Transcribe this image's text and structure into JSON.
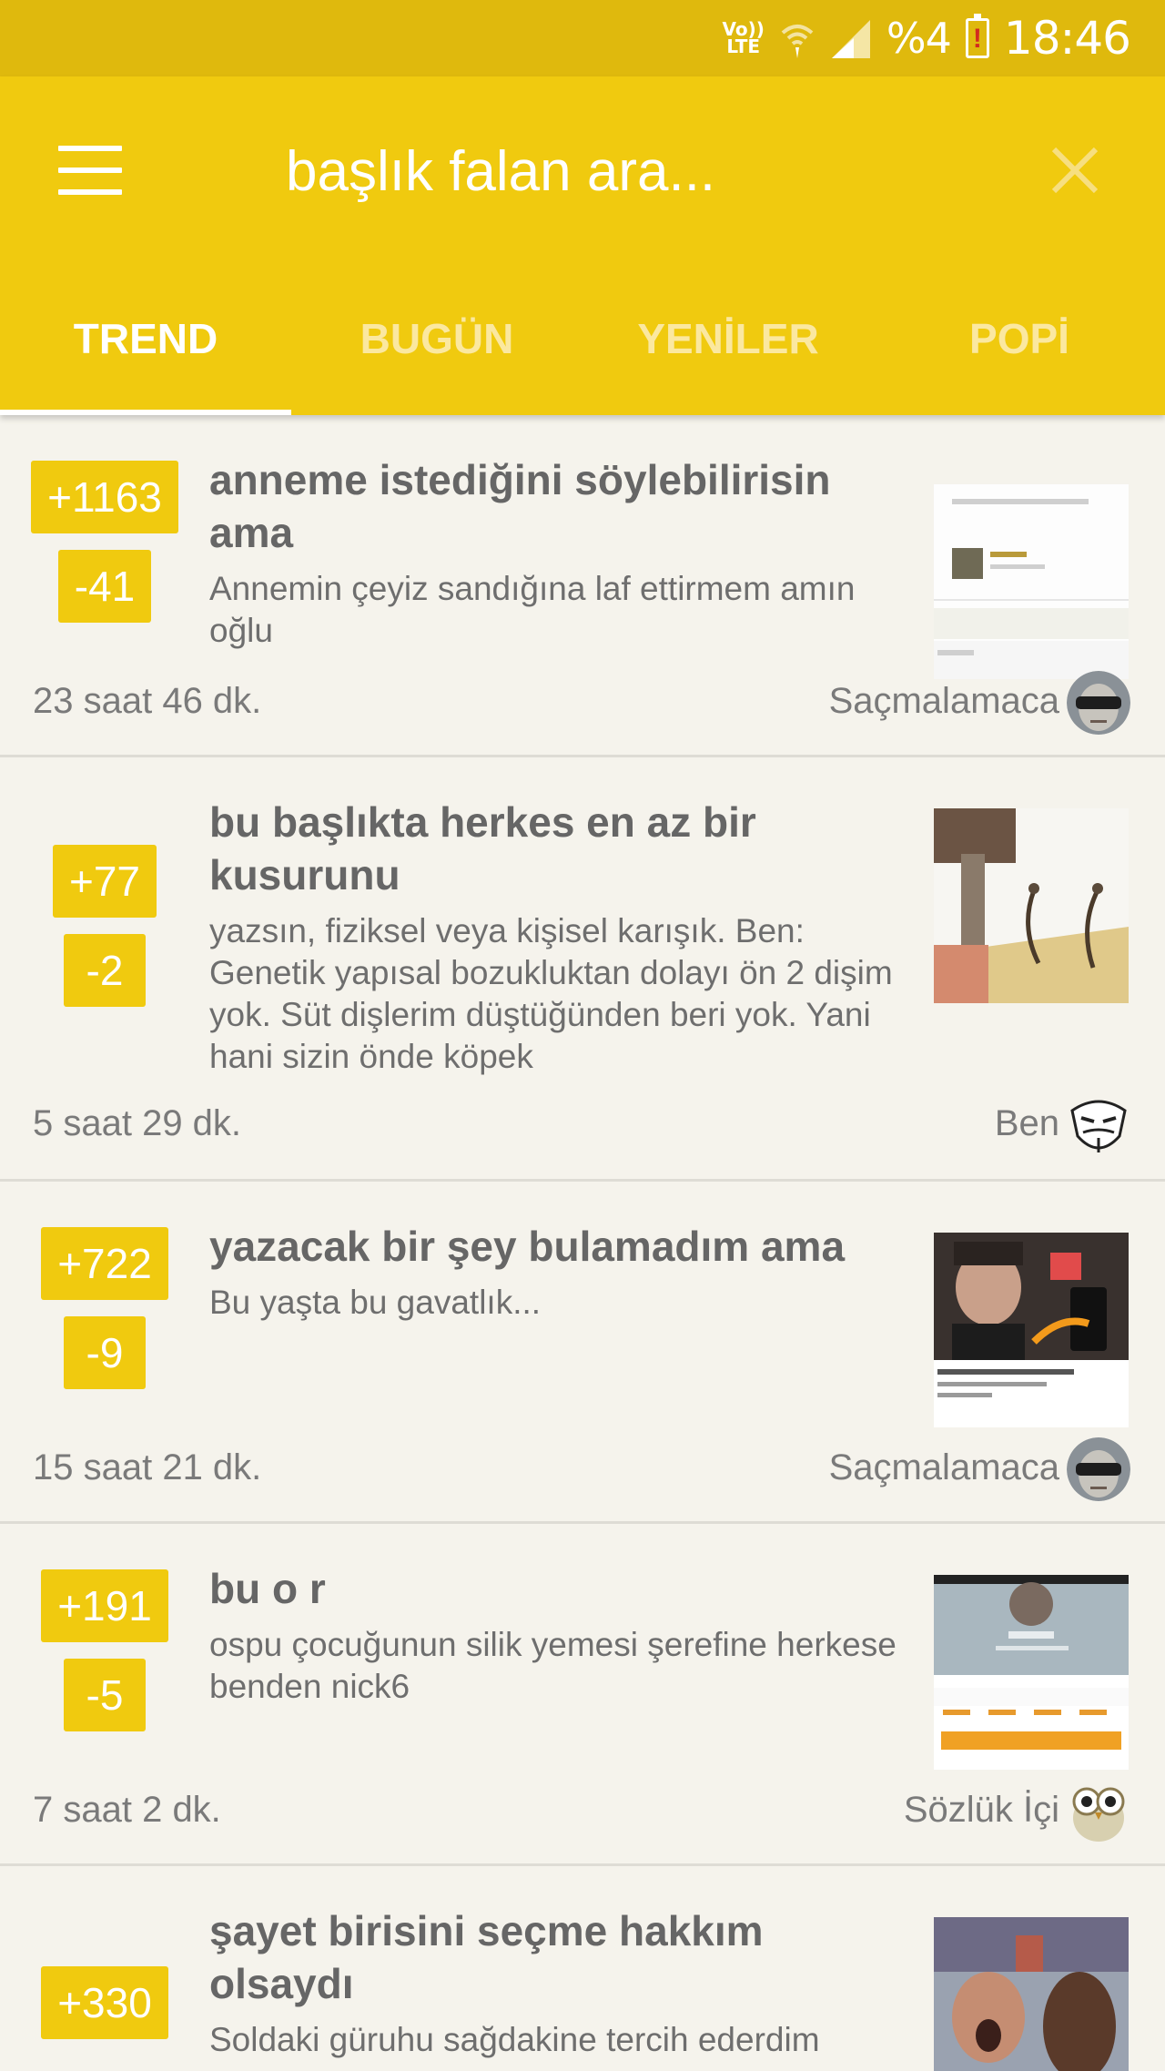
{
  "status_bar": {
    "network_label": "Vo)) LTE",
    "battery_percent": "%4",
    "battery_warning": "!",
    "time": "18:46"
  },
  "header": {
    "search_placeholder": "başlık falan ara...",
    "tabs": [
      {
        "label": "TREND",
        "active": true
      },
      {
        "label": "BUGÜN",
        "active": false
      },
      {
        "label": "YENİLER",
        "active": false
      },
      {
        "label": "POPİ",
        "active": false
      }
    ],
    "accent_color": "#f0ca0f"
  },
  "entries": [
    {
      "upvotes": "+1163",
      "downvotes": "-41",
      "title": "anneme istediğini söylebilirisin ama",
      "body": "Annemin çeyiz sandığına laf ettirmem amın oğlu",
      "time": "23 saat 46 dk.",
      "author": "Saçmalamaca",
      "avatar_icon": "sunglasses-face-avatar",
      "thumb_icon": "screenshot-thumbnail"
    },
    {
      "upvotes": "+77",
      "downvotes": "-2",
      "title": "bu başlıkta herkes en az bir kusurunu",
      "body": "yazsın, fiziksel veya kişisel karışık. Ben: Genetik yapısal bozukluktan dolayı ön 2 dişim yok. Süt dişlerim düştüğünden beri yok. Yani hani sizin önde köpek",
      "time": "5 saat 29 dk.",
      "author": "Ben",
      "avatar_icon": "mask-avatar",
      "thumb_icon": "hammer-nails-thumbnail"
    },
    {
      "upvotes": "+722",
      "downvotes": "-9",
      "title": "yazacak bir şey bulamadım ama",
      "body": "Bu yaşta bu gavatlık...",
      "time": "15 saat 21 dk.",
      "author": "Saçmalamaca",
      "avatar_icon": "sunglasses-face-avatar",
      "thumb_icon": "video-thumbnail"
    },
    {
      "upvotes": "+191",
      "downvotes": "-5",
      "title": "bu o r",
      "body": "ospu çocuğunun silik yemesi şerefine herkese benden nick6",
      "time": "7 saat 2 dk.",
      "author": "Sözlük İçi",
      "avatar_icon": "owl-avatar",
      "thumb_icon": "profile-screenshot-thumbnail"
    },
    {
      "upvotes": "+330",
      "downvotes": "",
      "title": "şayet birisini seçme hakkım olsaydı",
      "body": "Soldaki güruhu sağdakine tercih ederdim",
      "time": "",
      "author": "",
      "avatar_icon": "",
      "thumb_icon": "crowd-photo-thumbnail"
    }
  ]
}
